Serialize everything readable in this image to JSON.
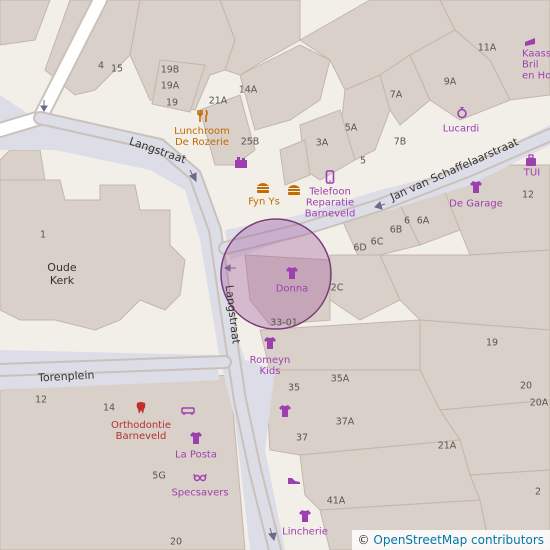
{
  "map": {
    "streets": {
      "langstraat_upper": "Langstraat",
      "langstraat_lower": "Langstraat",
      "torenplein": "Torenplein",
      "jan_van_schaffelaarstraat": "Jan van Schaffelaarstraat"
    },
    "places": {
      "oude_kerk": "Oude\nKerk"
    },
    "house_numbers": {
      "n4": "4",
      "n15": "15",
      "n19b": "19B",
      "n19a": "19A",
      "n19": "19",
      "n21a": "21A",
      "n14a": "14A",
      "n25b": "25B",
      "n3a": "3A",
      "n5a": "5A",
      "n5": "5",
      "n7a": "7A",
      "n7b": "7B",
      "n9a": "9A",
      "n11a": "11A",
      "n12": "12",
      "n6": "6",
      "n6a": "6A",
      "n6b": "6B",
      "n6c": "6C",
      "n6d": "6D",
      "n2c": "2C",
      "n1": "1",
      "n3301": "33-01",
      "n19r": "19",
      "n35": "35",
      "n35a": "35A",
      "n20": "20",
      "n20a": "20A",
      "n12b": "12",
      "n14": "14",
      "n37": "37",
      "n37a": "37A",
      "n21a2": "21A",
      "n5g": "5G",
      "n41a": "41A",
      "n20b": "20",
      "n2": "2"
    },
    "pois": {
      "lunchroom": "Lunchroom\nDe Rozerie",
      "fyn_ys": "Fyn Ys",
      "telefoon": "Telefoon\nReparatie\nBarneveld",
      "lucardi": "Lucardi",
      "kaasse": "Kaasse\nBril\nen Hoort",
      "tui": "TUI",
      "de_garage": "De Garage",
      "donna": "Donna",
      "romeyn": "Romeyn\nKids",
      "orthodontie": "Orthodontie\nBarneveld",
      "la_posta": "La Posta",
      "specsavers": "Specsavers",
      "lincherie": "Lincherie"
    },
    "colors": {
      "land": "#f2efe9",
      "building": "#d9d0c9",
      "building_stroke": "#c4b6ab",
      "road": "#ffffff",
      "road_casing": "#c9c2bb",
      "footway": "#dddde8",
      "poi": "#9e3fb0",
      "food": "#c26b00",
      "highlight": "#a05a9c"
    }
  },
  "attribution": {
    "symbol": "©",
    "link": "OpenStreetMap contributors"
  }
}
